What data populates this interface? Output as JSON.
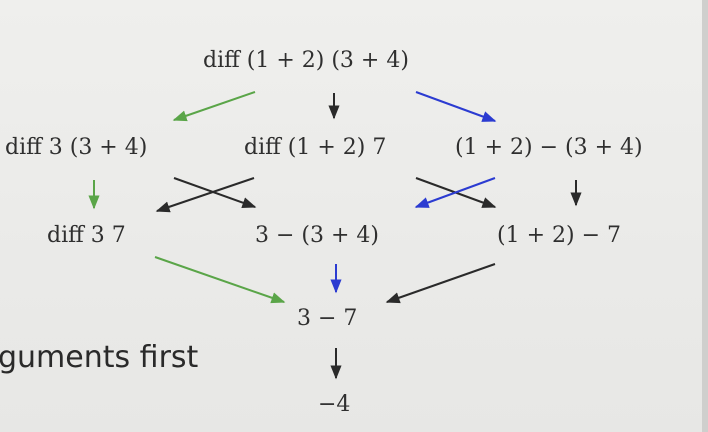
{
  "colors": {
    "green": "#5aa548",
    "blue": "#2b3bd1",
    "black": "#2a2a2a",
    "text": "#2f2f2f"
  },
  "nodes": {
    "root": "diff (1 + 2) (3 + 4)",
    "left1": "diff 3 (3 + 4)",
    "mid1": "diff (1 + 2) 7",
    "right1": "(1 + 2) − (3 + 4)",
    "left2": "diff 3 7",
    "mid2": "3 − (3 + 4)",
    "right2": "(1 + 2) − 7",
    "level3": "3 − 7",
    "result": "−4"
  },
  "caption": "guments first"
}
